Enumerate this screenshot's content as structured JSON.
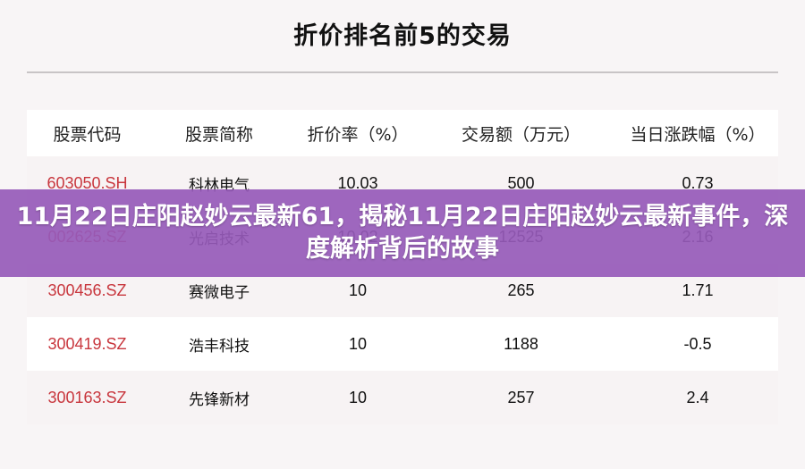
{
  "page": {
    "title": "折价排名前5的交易"
  },
  "table": {
    "headers": [
      "股票代码",
      "股票简称",
      "折价率（%）",
      "交易额（万元）",
      "当日涨跌幅（%）"
    ],
    "rows": [
      {
        "code": "603050.SH",
        "name": "科林电气",
        "discount_rate": "10.03",
        "amount": "500",
        "change": "0.73"
      },
      {
        "code": "002625.SZ",
        "name": "光启技术",
        "discount_rate": "10.02",
        "amount": "12525",
        "change": "2.16"
      },
      {
        "code": "300456.SZ",
        "name": "赛微电子",
        "discount_rate": "10",
        "amount": "265",
        "change": "1.71"
      },
      {
        "code": "300419.SZ",
        "name": "浩丰科技",
        "discount_rate": "10",
        "amount": "1188",
        "change": "-0.5"
      },
      {
        "code": "300163.SZ",
        "name": "先锋新材",
        "discount_rate": "10",
        "amount": "257",
        "change": "2.4"
      }
    ]
  },
  "banner": {
    "text": "11月22日庄阳赵妙云最新61，揭秘11月22日庄阳赵妙云最新事件，深度解析背后的故事"
  },
  "colors": {
    "code_text": "#c8363d",
    "banner_bg": "#965ab9",
    "row_alt_bg": "#f7f3f4"
  }
}
